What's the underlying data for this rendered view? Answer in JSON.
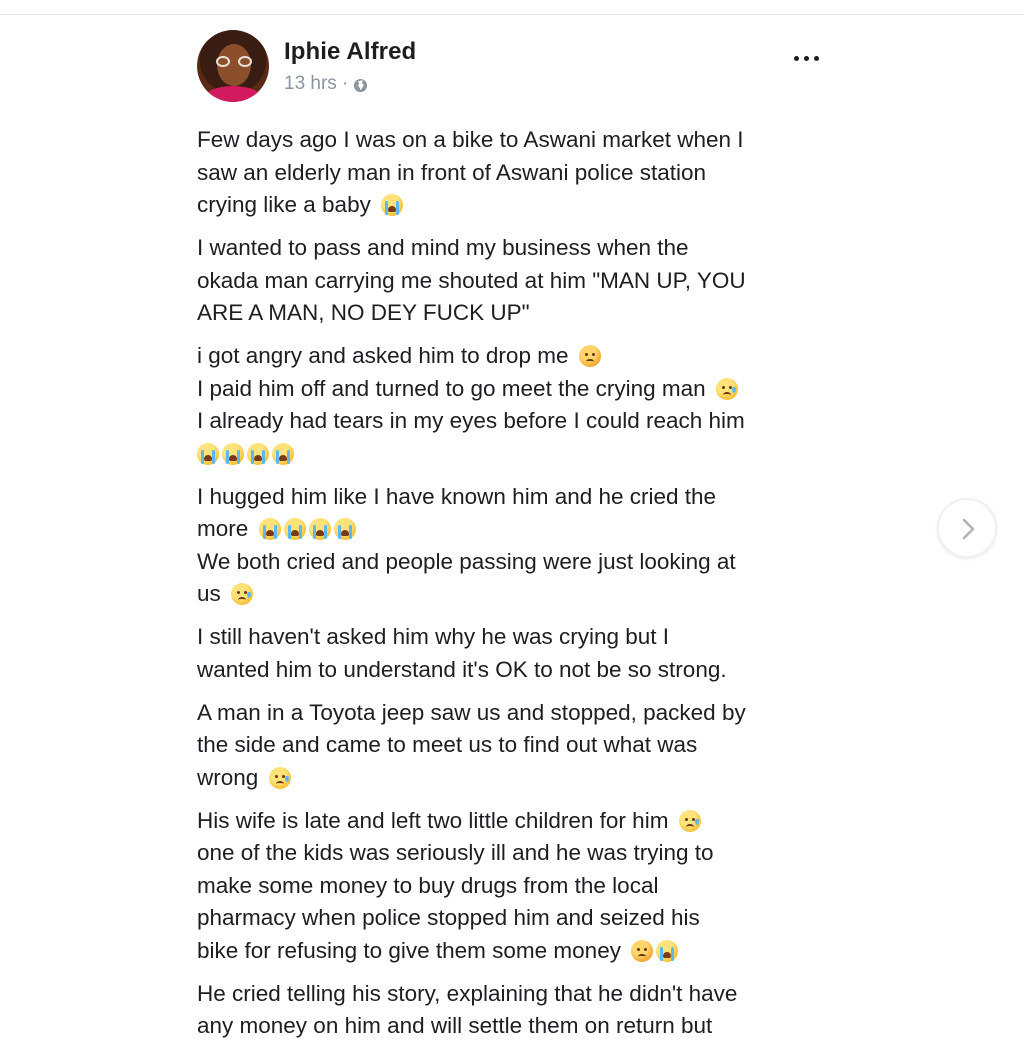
{
  "post": {
    "author": "Iphie Alfred",
    "time": "13 hrs",
    "separator": "·",
    "privacy_icon": "globe-icon",
    "more_icon": "ellipsis-icon"
  },
  "content": {
    "p1_l1": "Few days ago I was on a bike to Aswani market when I",
    "p1_l2": "saw an elderly man in front of Aswani police station",
    "p1_l3": "crying like a baby",
    "p2_l1": "I wanted to pass and mind my business when the",
    "p2_l2": "okada man carrying me shouted at him \"MAN UP, YOU",
    "p2_l3": "ARE A MAN, NO DEY FUCK UP\"",
    "p3_l1": "i got angry and asked him to drop me",
    "p3_l2": "I paid him off and turned to go meet the crying man",
    "p3_l3": "I already had tears in my eyes before I could reach him",
    "p4_l1": "I hugged him like I have known him and he cried the",
    "p4_l2": "more",
    "p4_l3": "We both cried and people passing were just looking at",
    "p4_l4": "us",
    "p5_l1": "I still haven't asked him why he was crying but I",
    "p5_l2": "wanted him to understand it's OK to not be so strong.",
    "p6_l1": "A man in a Toyota jeep saw us and stopped, packed by",
    "p6_l2": "the side and came to meet us to find out what was",
    "p6_l3": "wrong",
    "p7_l1": "His wife is late and left two little children for him",
    "p7_l2": "one of the kids was seriously ill and he was trying to",
    "p7_l3": "make some money to buy drugs from the local",
    "p7_l4": "pharmacy when police stopped him and seized his",
    "p7_l5": "bike for refusing to give them some money",
    "p8_l1": "He cried telling his story, explaining that he didn't have",
    "p8_l2": "any money on him and will settle them on return but"
  },
  "colors": {
    "text": "#1c1e21",
    "meta": "#8d949e",
    "divider": "#e4e6eb"
  },
  "navigation": {
    "next_icon": "chevron-right-icon"
  }
}
